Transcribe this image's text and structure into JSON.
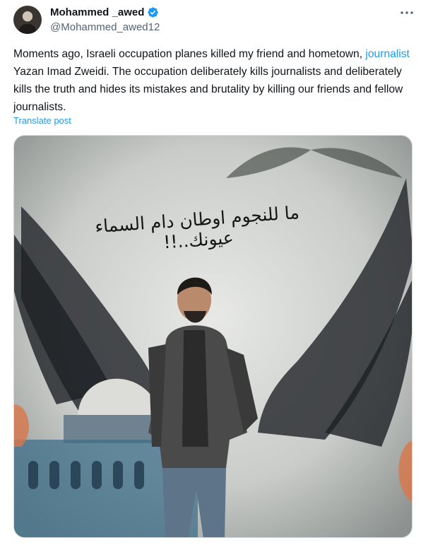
{
  "author": {
    "display_name": "Mohammed _awed",
    "handle": "@Mohammed_awed12",
    "verified": true,
    "avatar_icon": "user-avatar"
  },
  "post": {
    "text_part1": "Moments ago, Israeli occupation planes killed my friend and hometown,",
    "link_word": "journalist",
    "text_part2": " Yazan Imad Zweidi. The occupation deliberately kills journalists and deliberately kills the truth and hides its mistakes and brutality by killing our friends and fellow journalists.",
    "translate_label": "Translate post"
  },
  "media": {
    "mural_text": "ما للنجوم اوطان دام السماء عيونك..!!"
  },
  "colors": {
    "link": "#1d9bf0",
    "secondary_text": "#536471",
    "primary_text": "#0f1419",
    "verified_badge": "#1d9bf0"
  },
  "icons": {
    "more": "more-options-icon",
    "verified": "verified-badge-icon"
  }
}
